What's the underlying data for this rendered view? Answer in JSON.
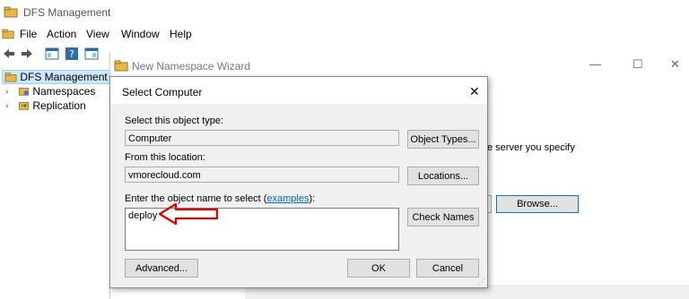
{
  "app": {
    "title": "DFS Management"
  },
  "menu": [
    "File",
    "Action",
    "View",
    "Window",
    "Help"
  ],
  "tree": {
    "root": "DFS Management",
    "items": [
      "Namespaces",
      "Replication"
    ]
  },
  "wizard": {
    "title": "New Namespace Wizard",
    "body_text": "e server you specify",
    "browse_label": "Browse..."
  },
  "dialog": {
    "title": "Select Computer",
    "object_type_label": "Select this object type:",
    "object_type_value": "Computer",
    "object_types_button": "Object Types...",
    "location_label": "From this location:",
    "location_value": "vmorecloud.com",
    "locations_button": "Locations...",
    "enter_label": "Enter the object name to select (",
    "examples_link": "examples",
    "enter_label_end": "):",
    "object_name_value": "deploy",
    "check_names_button": "Check Names",
    "advanced_button": "Advanced...",
    "ok_button": "OK",
    "cancel_button": "Cancel"
  },
  "colors": {
    "annotation_arrow": "#e00000",
    "selection": "#cce8ff",
    "link": "#0066cc"
  }
}
